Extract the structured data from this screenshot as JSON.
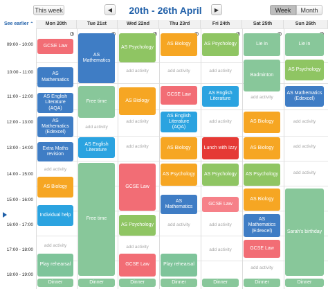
{
  "toolbar": {
    "this_week": "This week",
    "title": "20th - 26th April",
    "prev": "◀",
    "next": "▶",
    "week": "Week",
    "month": "Month"
  },
  "see_earlier": "See earlier",
  "days": [
    "Mon 20th",
    "Tue 21st",
    "Wed 22nd",
    "Thu 23rd",
    "Fri 24th",
    "Sat 25th",
    "Sun 26th"
  ],
  "times": [
    "09:00 - 10:00",
    "10:00 - 11:00",
    "11:00 - 12:00",
    "12:00 - 13:00",
    "13:00 - 14:00",
    "14:00 - 15:00",
    "15:00 - 16:00",
    "16:00 - 17:00",
    "17:00 - 18:00",
    "18:00 - 19:00"
  ],
  "add_activity": "add activity",
  "events": {
    "mon_gcse": "GCSE Law",
    "mon_asmath": "AS Mathematics",
    "mon_aseng": "AS English Literature (AQA)",
    "mon_asmathx": "AS Mathematics (Edexcel)",
    "mon_extra": "Extra Maths revision",
    "mon_bio": "AS Biology",
    "mon_help": "Individual help",
    "mon_play": "Play rehearsal",
    "mon_dinner": "Dinner",
    "tue_asmath": "AS Mathematics",
    "tue_free1": "Free time",
    "tue_aseng": "AS English Literature",
    "tue_free2": "Free time",
    "tue_dinner": "Dinner",
    "wed_psy": "AS Psychology",
    "wed_bio": "AS Biology",
    "wed_gcse": "GCSE Law",
    "wed_psy2": "AS Psychology",
    "wed_gcse2": "GCSE Law",
    "wed_dinner": "Dinner",
    "thu_bio": "AS Biology",
    "thu_gcse": "GCSE Law",
    "thu_eng": "AS English Literature (AQA)",
    "thu_bio2": "AS Biology",
    "thu_psy": "AS Psychology",
    "thu_math": "AS Mathematics",
    "thu_play": "Play rehearsal",
    "thu_dinner": "Dinner",
    "fri_psy": "AS Psychology",
    "fri_eng": "AS English Literature",
    "fri_lunch": "Lunch with Izzy",
    "fri_psy2": "AS Psychology",
    "fri_gcse": "GCSE Law",
    "fri_dinner": "Dinner",
    "sat_lie": "Lie in",
    "sat_bad": "Badminton",
    "sat_bio": "AS Biology",
    "sat_bio2": "AS Biology",
    "sat_psy": "AS Psychology",
    "sat_bio3": "AS Biology",
    "sat_math": "AS Mathematics (Edexcel)",
    "sat_gcse": "GCSE Law",
    "sat_dinner": "Dinner",
    "sun_lie": "Lie in",
    "sun_psy": "AS Psychology",
    "sun_math": "AS Mathematics (Edexcel)",
    "sun_bday": "Sarah's birthday",
    "sun_dinner": "Dinner"
  }
}
